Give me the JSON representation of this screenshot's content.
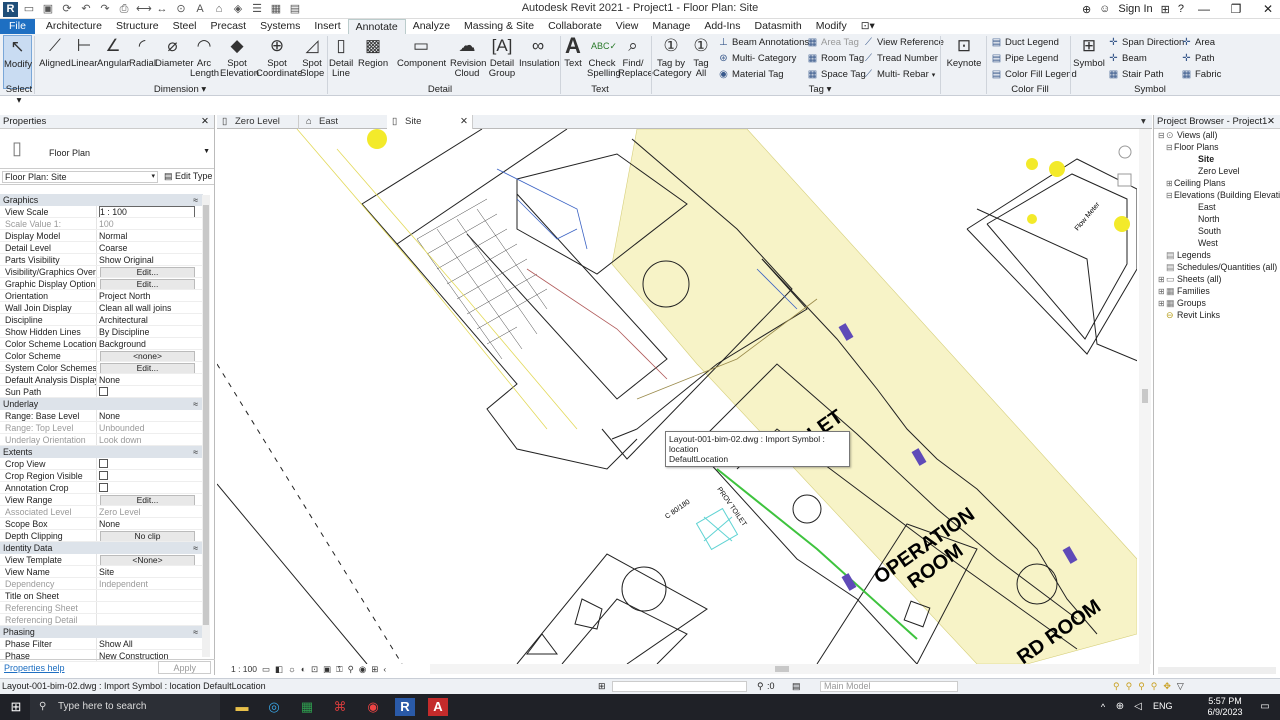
{
  "app": {
    "title": "Autodesk Revit 2021 - Project1 - Floor Plan: Site",
    "logo": "R"
  },
  "title_right": {
    "sign_in": "Sign In"
  },
  "menu": [
    "File",
    "Architecture",
    "Structure",
    "Steel",
    "Precast",
    "Systems",
    "Insert",
    "Annotate",
    "Analyze",
    "Massing & Site",
    "Collaborate",
    "View",
    "Manage",
    "Add-Ins",
    "Datasmith",
    "Modify"
  ],
  "ribbon": {
    "modify": "Modify",
    "aligned": "Aligned",
    "linear": "Linear",
    "angular": "Angular",
    "radial": "Radial",
    "diameter": "Diameter",
    "arc_length": "Arc Length",
    "spot_elevation": "Spot Elevation",
    "spot_coordinate": "Spot Coordinate",
    "spot_slope": "Spot Slope",
    "detail_line": "Detail Line",
    "region": "Region",
    "component": "Component",
    "revision_cloud": "Revision Cloud",
    "detail_group": "Detail Group",
    "insulation": "Insulation",
    "text": "Text",
    "check_spelling": "Check Spelling",
    "find_replace": "Find/ Replace",
    "tag_by_category": "Tag by Category",
    "tag_all": "Tag All",
    "beam_annotations": "Beam Annotations",
    "multi_category": "Multi- Category",
    "material_tag": "Material Tag",
    "area_tag": "Area Tag",
    "room_tag": "Room Tag",
    "space_tag": "Space Tag",
    "view_reference": "View Reference",
    "tread_number": "Tread Number",
    "multi_rebar": "Multi- Rebar",
    "keynote": "Keynote",
    "duct_legend": "Duct Legend",
    "pipe_legend": "Pipe Legend",
    "color_fill_legend": "Color Fill Legend",
    "symbol": "Symbol",
    "span_direction": "Span Direction",
    "beam": "Beam",
    "stair_path": "Stair Path",
    "area": "Area",
    "path": "Path",
    "fabric": "Fabric",
    "panels": {
      "select": "Select",
      "dimension": "Dimension",
      "detail": "Detail",
      "text": "Text",
      "tag": "Tag",
      "color_fill": "Color Fill",
      "symbol": "Symbol"
    }
  },
  "tabs": [
    "Zero Level",
    "East",
    "Site"
  ],
  "properties": {
    "header": "Properties",
    "type_name": "Floor Plan",
    "instance": "Floor Plan: Site",
    "edit_type": "Edit Type",
    "groups": {
      "graphics": "Graphics",
      "underlay": "Underlay",
      "extents": "Extents",
      "identity": "Identity Data",
      "phasing": "Phasing"
    },
    "rows": {
      "view_scale": [
        "View Scale",
        "1 : 100"
      ],
      "scale_value": [
        "Scale Value    1:",
        "100"
      ],
      "display_model": [
        "Display Model",
        "Normal"
      ],
      "detail_level": [
        "Detail Level",
        "Coarse"
      ],
      "parts_visibility": [
        "Parts Visibility",
        "Show Original"
      ],
      "vg": [
        "Visibility/Graphics Overr...",
        "Edit..."
      ],
      "gdo": [
        "Graphic Display Options",
        "Edit..."
      ],
      "orientation": [
        "Orientation",
        "Project North"
      ],
      "wall_join": [
        "Wall Join Display",
        "Clean all wall joins"
      ],
      "discipline": [
        "Discipline",
        "Architectural"
      ],
      "hidden_lines": [
        "Show Hidden Lines",
        "By Discipline"
      ],
      "csl": [
        "Color Scheme Location",
        "Background"
      ],
      "color_scheme": [
        "Color Scheme",
        "<none>"
      ],
      "system_cs": [
        "System Color Schemes",
        "Edit..."
      ],
      "default_analysis": [
        "Default Analysis Display...",
        "None"
      ],
      "sun_path": [
        "Sun Path",
        ""
      ],
      "range_base": [
        "Range: Base Level",
        "None"
      ],
      "range_top": [
        "Range: Top Level",
        "Unbounded"
      ],
      "underlay_orient": [
        "Underlay Orientation",
        "Look down"
      ],
      "crop_view": [
        "Crop View",
        ""
      ],
      "crop_region": [
        "Crop Region Visible",
        ""
      ],
      "annotation_crop": [
        "Annotation Crop",
        ""
      ],
      "view_range": [
        "View Range",
        "Edit..."
      ],
      "assoc_level": [
        "Associated Level",
        "Zero Level"
      ],
      "scope_box": [
        "Scope Box",
        "None"
      ],
      "depth_clip": [
        "Depth Clipping",
        "No clip"
      ],
      "view_template": [
        "View Template",
        "<None>"
      ],
      "view_name": [
        "View Name",
        "Site"
      ],
      "dependency": [
        "Dependency",
        "Independent"
      ],
      "title_sheet": [
        "Title on Sheet",
        ""
      ],
      "ref_sheet": [
        "Referencing Sheet",
        ""
      ],
      "ref_detail": [
        "Referencing Detail",
        ""
      ],
      "phase_filter": [
        "Phase Filter",
        "Show All"
      ],
      "phase": [
        "Phase",
        "New Construction"
      ]
    },
    "help": "Properties help",
    "apply": "Apply"
  },
  "canvas": {
    "tooltip_line1": "Layout-001-bim-02.dwg : Import Symbol : location",
    "tooltip_line2": "DefaultLocation",
    "room1": "OPERATION",
    "room1b": "ROOM",
    "room2": "RD ROOM",
    "toilet": "LET",
    "small1": "Flow Meter",
    "small2": "C 80/180",
    "small3": "PROV TOILET"
  },
  "view_control": {
    "scale": "1 : 100"
  },
  "browser": {
    "header": "Project Browser - Project1",
    "items": [
      "Views (all)",
      "Floor Plans",
      "Site",
      "Zero Level",
      "Ceiling Plans",
      "Elevations (Building Elevati",
      "East",
      "North",
      "South",
      "West",
      "Legends",
      "Schedules/Quantities (all)",
      "Sheets (all)",
      "Families",
      "Groups",
      "Revit Links"
    ]
  },
  "status": {
    "text": "Layout-001-bim-02.dwg : Import Symbol : location DefaultLocation",
    "zero": ":0",
    "model": "Main Model"
  },
  "taskbar": {
    "search": "Type here to search",
    "lang": "ENG",
    "time": "5:57 PM",
    "date": "6/9/2023"
  }
}
